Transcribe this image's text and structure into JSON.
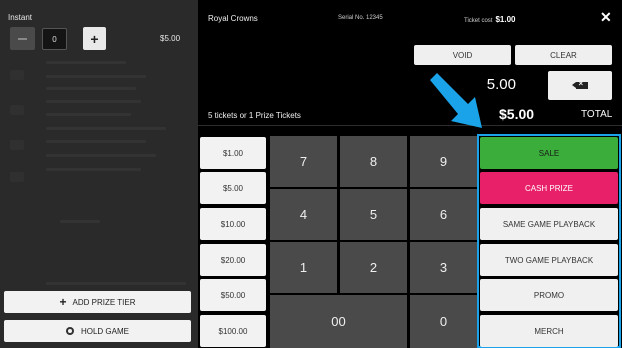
{
  "left_panel": {
    "section_title": "Instant",
    "quantity": "0",
    "minus_icon": "minus-icon",
    "plus_label": "+",
    "price": "$5.00",
    "add_prize_tier_icon": "plus-icon",
    "add_prize_tier_label": "ADD PRIZE TIER",
    "hold_game_icon": "record-icon",
    "hold_game_label": "HOLD GAME"
  },
  "header": {
    "game_name": "Royal Crowns",
    "serial": "Serial No. 12345",
    "ticket_cost_label": "Ticket cost",
    "ticket_cost_value": "$1.00",
    "close_label": "✕"
  },
  "controls": {
    "void_label": "VOID",
    "clear_label": "CLEAR",
    "amount_entry": "5.00",
    "backspace_icon": "backspace-icon"
  },
  "summary": {
    "tickets_text": "5 tickets or 1 Prize Tickets",
    "total_amount": "$5.00",
    "total_label": "TOTAL"
  },
  "quick_amounts": [
    "$1.00",
    "$5.00",
    "$10.00",
    "$20.00",
    "$50.00",
    "$100.00"
  ],
  "keypad": [
    "7",
    "8",
    "9",
    "4",
    "5",
    "6",
    "1",
    "2",
    "3",
    "00",
    "0"
  ],
  "actions": [
    "SALE",
    "CASH PRIZE",
    "SAME GAME PLAYBACK",
    "TWO GAME PLAYBACK",
    "PROMO",
    "MERCH"
  ],
  "colors": {
    "sale": "#3aad3a",
    "cash_prize": "#e8206a",
    "highlight": "#1aa3e8"
  }
}
